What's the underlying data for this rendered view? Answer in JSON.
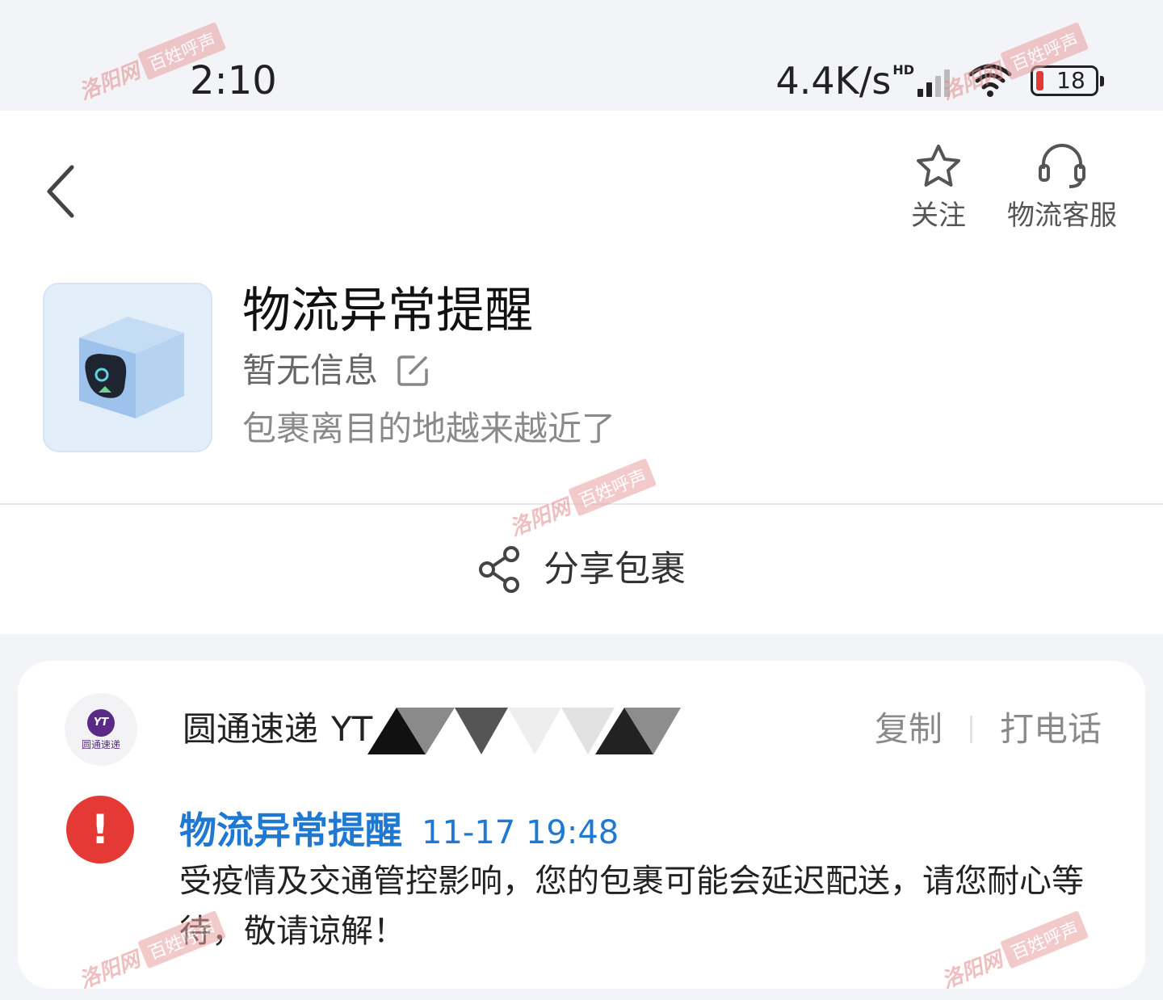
{
  "status_bar": {
    "time": "2:10",
    "net_speed": "4.4K/s",
    "hd": "HD",
    "battery": "18",
    "battery_color": "#e53935"
  },
  "header": {
    "back_icon": "chevron-left-icon",
    "follow_label": "关注",
    "service_label": "物流客服",
    "icons": [
      "star-icon",
      "headset-icon"
    ]
  },
  "notice": {
    "title": "物流异常提醒",
    "info": "暂无信息",
    "description": "包裹离目的地越来越近了"
  },
  "share": {
    "label": "分享包裹",
    "icon": "share-icon"
  },
  "package": {
    "courier_logo_text": "YT",
    "courier_logo_name": "圆通速递",
    "courier_name": "圆通速递",
    "tracking_prefix": "YT",
    "copy_label": "复制",
    "call_label": "打电话",
    "event": {
      "title": "物流异常提醒",
      "time": "11-17  19:48",
      "body": "受疫情及交通管控影响，您的包裹可能会延迟配送，请您耐心等待，敬请谅解！",
      "alert_mark": "!"
    }
  },
  "watermark": {
    "site": "洛阳网",
    "tag": "百姓呼声"
  },
  "colors": {
    "accent_blue": "#1f78d1",
    "alert_red": "#e53935",
    "background": "#f2f4f8"
  }
}
